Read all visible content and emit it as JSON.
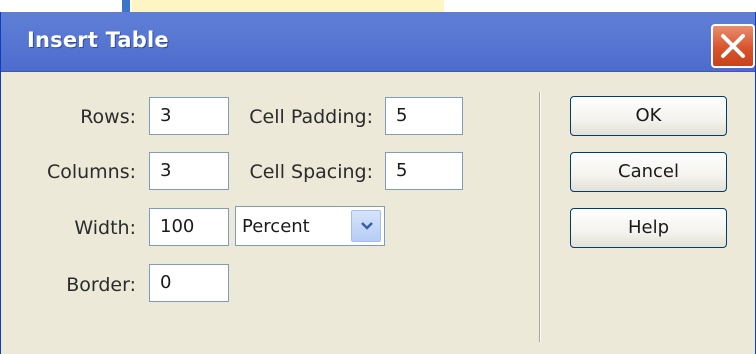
{
  "window": {
    "title": "Insert Table"
  },
  "fields": {
    "rows": {
      "label": "Rows:",
      "value": "3"
    },
    "columns": {
      "label": "Columns:",
      "value": "3"
    },
    "width": {
      "label": "Width:",
      "value": "100"
    },
    "border": {
      "label": "Border:",
      "value": "0"
    },
    "cell_padding": {
      "label": "Cell Padding:",
      "value": "5"
    },
    "cell_spacing": {
      "label": "Cell Spacing:",
      "value": "5"
    },
    "width_unit": {
      "selected": "Percent"
    }
  },
  "buttons": {
    "ok": "OK",
    "cancel": "Cancel",
    "help": "Help"
  },
  "icons": {
    "close": "close-icon",
    "dropdown": "chevron-down-icon"
  },
  "colors": {
    "titlebar": "#5877d3",
    "dialog_bg": "#ece9d8",
    "close_button": "#d9542c"
  }
}
